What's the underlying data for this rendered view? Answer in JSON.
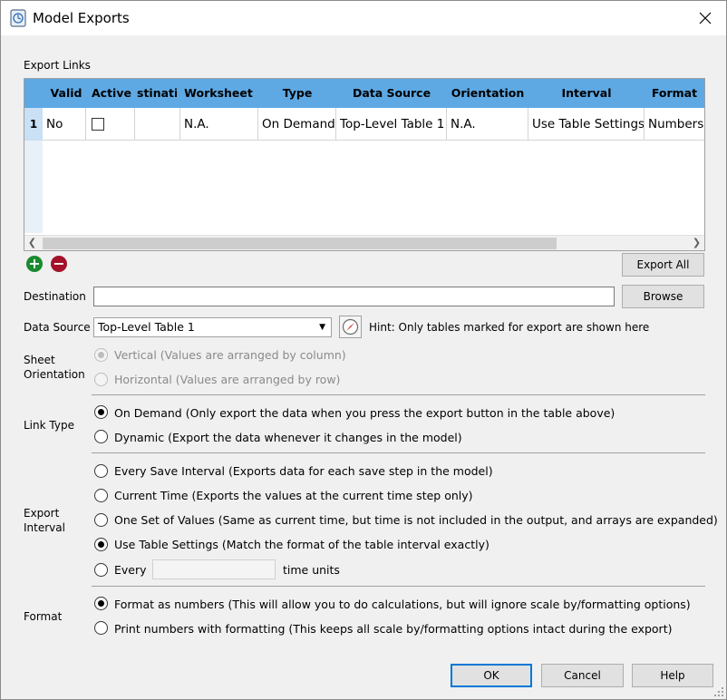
{
  "window": {
    "title": "Model Exports"
  },
  "export_links": {
    "label": "Export Links",
    "columns": [
      "Valid",
      "Active",
      "stinati",
      "Worksheet",
      "Type",
      "Data Source",
      "Orientation",
      "Interval",
      "Format"
    ],
    "rows": [
      {
        "num": "1",
        "valid": "No",
        "active": false,
        "destination": "",
        "worksheet": "N.A.",
        "type": "On Demand",
        "data_source": "Top-Level Table 1",
        "orientation": "N.A.",
        "interval": "Use Table Settings",
        "format": "Numbers"
      }
    ]
  },
  "buttons": {
    "export_all": "Export All",
    "browse": "Browse",
    "ok": "OK",
    "cancel": "Cancel",
    "help": "Help"
  },
  "destination": {
    "label": "Destination",
    "value": ""
  },
  "data_source": {
    "label": "Data Source",
    "selected": "Top-Level Table 1",
    "hint": "Hint: Only tables marked for export are shown here"
  },
  "sheet_orientation": {
    "label_line1": "Sheet",
    "label_line2": "Orientation",
    "options": [
      "Vertical (Values are arranged by column)",
      "Horizontal (Values are arranged by row)"
    ],
    "selected": 0
  },
  "link_type": {
    "label": "Link Type",
    "options": [
      "On Demand (Only export the data when you press the export button in the table above)",
      "Dynamic (Export the data whenever it changes in the model)"
    ],
    "selected": 0
  },
  "export_interval": {
    "label_line1": "Export",
    "label_line2": "Interval",
    "options": [
      "Every Save Interval (Exports data for each save step in the model)",
      "Current Time (Exports the values at the current time step only)",
      "One Set of Values (Same as current time, but time is not included in the output, and arrays are expanded)",
      "Use Table Settings (Match the format of the table interval exactly)",
      "Every"
    ],
    "every_value": "",
    "units": "time units",
    "selected": 3
  },
  "format": {
    "label": "Format",
    "options": [
      "Format as numbers (This will allow you to do calculations, but will ignore scale by/formatting options)",
      "Print numbers with formatting (This keeps all scale by/formatting options intact during the export)"
    ],
    "selected": 0
  },
  "colors": {
    "header": "#5ea9e4",
    "accent": "#0078d7",
    "add": "#1a8a2e",
    "remove": "#a3122a"
  }
}
